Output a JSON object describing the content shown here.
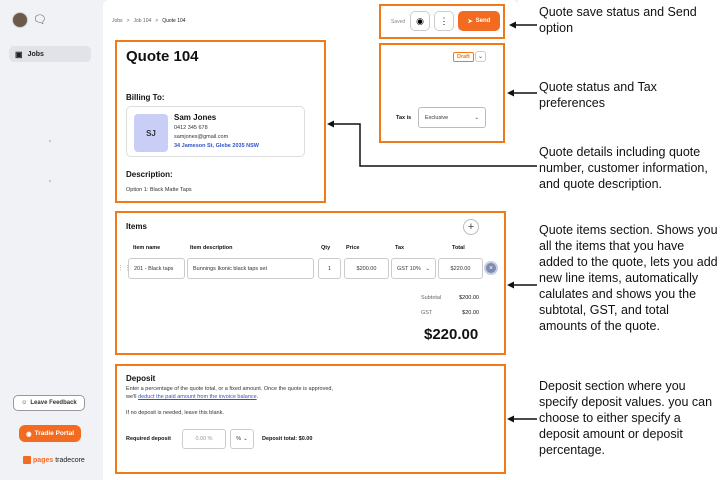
{
  "sidebar": {
    "nav_jobs_label": "Jobs",
    "feedback_label": "Leave Feedback",
    "portal_label": "Tradie Portal",
    "brand_primary": "pages",
    "brand_secondary": "tradecore"
  },
  "breadcrumb": {
    "jobs": "Jobs",
    "job": "Job 104",
    "current": "Quote 104",
    "separator": ">"
  },
  "header": {
    "saved_status": "Saved",
    "send_label": "Send"
  },
  "quote": {
    "title": "Quote 104",
    "billing_label": "Billing To:",
    "status": "Draft",
    "tax_label": "Tax is",
    "tax_value": "Exclusive",
    "description_label": "Description:",
    "description": "Option 1: Black Matte Taps"
  },
  "customer": {
    "initials": "SJ",
    "name": "Sam Jones",
    "phone": "0412 345 678",
    "email": "samjones@gmail.com",
    "address": "34 Jameson St, Glebe 2035 NSW"
  },
  "items": {
    "title": "Items",
    "headers": [
      "Item name",
      "Item description",
      "Qty",
      "Price",
      "Tax",
      "Total"
    ],
    "rows": [
      {
        "name": "201 - Black taps",
        "description": "Bunnings Ikonic black taps set",
        "qty": "1",
        "price": "$200.00",
        "tax": "GST 10%",
        "total": "$220.00"
      }
    ],
    "subtotal_label": "Subtotal",
    "subtotal": "$200.00",
    "gst_label": "GST",
    "gst": "$20.00",
    "total": "$220.00"
  },
  "deposit": {
    "title": "Deposit",
    "text1": "Enter a percentage of the quote total, or a fixed amount. Once the quote is approved,",
    "text2_prefix": "we'll ",
    "text2_link": "deduct the paid amount from the invoice balance",
    "text2_suffix": ".",
    "text3": "If no deposit is needed, leave this blank.",
    "required_label": "Required deposit",
    "input_placeholder": "0.00 %",
    "unit": "%",
    "total_text": "Deposit total: $0.00"
  },
  "annotations": {
    "status": "Quote save status and Send option",
    "tax": "Quote status and Tax preferences",
    "details": "Quote details including  quote number, customer information, and quote description.",
    "items": "Quote items section. Shows you all the items that you have added to the quote, lets you add new line items, automatically calulates and shows you the subtotal, GST, and total amounts of the quote.",
    "deposit": "Deposit section where you specify deposit values. you can choose to either specify a deposit amount or deposit percentage."
  },
  "colors": {
    "accent": "#f26b21",
    "highlight_box": "#f07a1a",
    "link": "#3553c4"
  }
}
